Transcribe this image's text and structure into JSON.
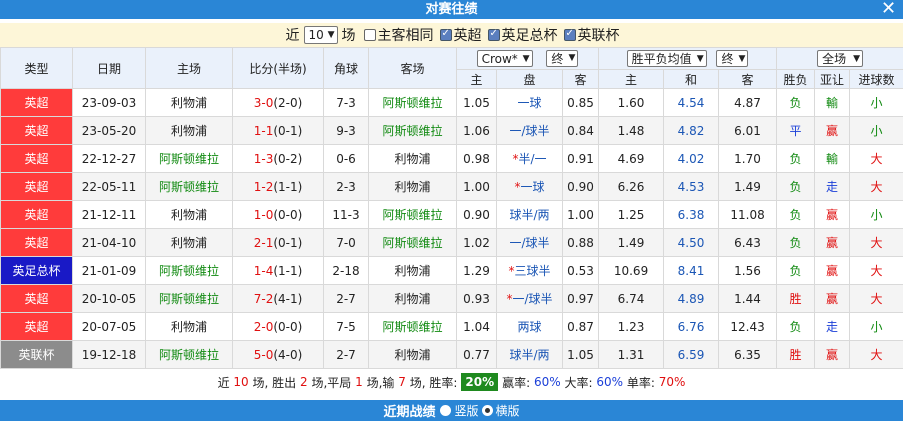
{
  "title": "对赛往绩",
  "filter": {
    "prefix": "近",
    "count": "10",
    "suffix": "场",
    "same_home": "主客相同",
    "same_home_checked": false,
    "leagues": [
      {
        "label": "英超",
        "checked": true
      },
      {
        "label": "英足总杯",
        "checked": true
      },
      {
        "label": "英联杯",
        "checked": true
      }
    ]
  },
  "header": {
    "type": "类型",
    "date": "日期",
    "home": "主场",
    "score": "比分(半场)",
    "corner": "角球",
    "away": "客场",
    "company": "Crow*",
    "odds_mode": "终",
    "euro_mode": "胜平负均值",
    "euro_odds_mode": "终",
    "result_scope": "全场",
    "sub_home": "主",
    "sub_line": "盘",
    "sub_away": "客",
    "sub_win": "主",
    "sub_draw": "和",
    "sub_lose": "客",
    "sub_result": "胜负",
    "sub_handicap": "亚让",
    "sub_goals": "进球数"
  },
  "rows": [
    {
      "league": "英超",
      "league_color": "red",
      "date": "23-09-03",
      "home": "利物浦",
      "home_green": false,
      "score_a": "3",
      "score_b": "0",
      "half": "(2-0)",
      "corner": "7-3",
      "away": "阿斯顿维拉",
      "away_green": true,
      "o_home": "1.05",
      "line_prefix": "",
      "line": "一球",
      "o_away": "0.85",
      "e_win": "1.60",
      "e_draw": "4.54",
      "e_lose": "4.87",
      "result": "负",
      "result_color": "green",
      "hcap": "輸",
      "hcap_color": "green",
      "goals": "小",
      "goals_color": "green"
    },
    {
      "league": "英超",
      "league_color": "red",
      "date": "23-05-20",
      "home": "利物浦",
      "home_green": false,
      "score_a": "1",
      "score_b": "1",
      "half": "(0-1)",
      "corner": "9-3",
      "away": "阿斯顿维拉",
      "away_green": true,
      "o_home": "1.06",
      "line_prefix": "",
      "line": "一/球半",
      "o_away": "0.84",
      "e_win": "1.48",
      "e_draw": "4.82",
      "e_lose": "6.01",
      "result": "平",
      "result_color": "blue",
      "hcap": "赢",
      "hcap_color": "red",
      "goals": "小",
      "goals_color": "green"
    },
    {
      "league": "英超",
      "league_color": "red",
      "date": "22-12-27",
      "home": "阿斯顿维拉",
      "home_green": true,
      "score_a": "1",
      "score_b": "3",
      "half": "(0-2)",
      "corner": "0-6",
      "away": "利物浦",
      "away_green": false,
      "o_home": "0.98",
      "line_prefix": "*",
      "line": "半/一",
      "o_away": "0.91",
      "e_win": "4.69",
      "e_draw": "4.02",
      "e_lose": "1.70",
      "result": "负",
      "result_color": "green",
      "hcap": "輸",
      "hcap_color": "green",
      "goals": "大",
      "goals_color": "red"
    },
    {
      "league": "英超",
      "league_color": "red",
      "date": "22-05-11",
      "home": "阿斯顿维拉",
      "home_green": true,
      "score_a": "1",
      "score_b": "2",
      "half": "(1-1)",
      "corner": "2-3",
      "away": "利物浦",
      "away_green": false,
      "o_home": "1.00",
      "line_prefix": "*",
      "line": "一球",
      "o_away": "0.90",
      "e_win": "6.26",
      "e_draw": "4.53",
      "e_lose": "1.49",
      "result": "负",
      "result_color": "green",
      "hcap": "走",
      "hcap_color": "blue",
      "goals": "大",
      "goals_color": "red"
    },
    {
      "league": "英超",
      "league_color": "red",
      "date": "21-12-11",
      "home": "利物浦",
      "home_green": false,
      "score_a": "1",
      "score_b": "0",
      "half": "(0-0)",
      "corner": "11-3",
      "away": "阿斯顿维拉",
      "away_green": true,
      "o_home": "0.90",
      "line_prefix": "",
      "line": "球半/两",
      "o_away": "1.00",
      "e_win": "1.25",
      "e_draw": "6.38",
      "e_lose": "11.08",
      "result": "负",
      "result_color": "green",
      "hcap": "赢",
      "hcap_color": "red",
      "goals": "小",
      "goals_color": "green"
    },
    {
      "league": "英超",
      "league_color": "red",
      "date": "21-04-10",
      "home": "利物浦",
      "home_green": false,
      "score_a": "2",
      "score_b": "1",
      "half": "(0-1)",
      "corner": "7-0",
      "away": "阿斯顿维拉",
      "away_green": true,
      "o_home": "1.02",
      "line_prefix": "",
      "line": "一/球半",
      "o_away": "0.88",
      "e_win": "1.49",
      "e_draw": "4.50",
      "e_lose": "6.43",
      "result": "负",
      "result_color": "green",
      "hcap": "赢",
      "hcap_color": "red",
      "goals": "大",
      "goals_color": "red"
    },
    {
      "league": "英足总杯",
      "league_color": "blue",
      "date": "21-01-09",
      "home": "阿斯顿维拉",
      "home_green": true,
      "score_a": "1",
      "score_b": "4",
      "half": "(1-1)",
      "corner": "2-18",
      "away": "利物浦",
      "away_green": false,
      "o_home": "1.29",
      "line_prefix": "*",
      "line": "三球半",
      "o_away": "0.53",
      "e_win": "10.69",
      "e_draw": "8.41",
      "e_lose": "1.56",
      "result": "负",
      "result_color": "green",
      "hcap": "赢",
      "hcap_color": "red",
      "goals": "大",
      "goals_color": "red"
    },
    {
      "league": "英超",
      "league_color": "red",
      "date": "20-10-05",
      "home": "阿斯顿维拉",
      "home_green": true,
      "score_a": "7",
      "score_b": "2",
      "half": "(4-1)",
      "corner": "2-7",
      "away": "利物浦",
      "away_green": false,
      "o_home": "0.93",
      "line_prefix": "*",
      "line": "一/球半",
      "o_away": "0.97",
      "e_win": "6.74",
      "e_draw": "4.89",
      "e_lose": "1.44",
      "result": "胜",
      "result_color": "red",
      "hcap": "赢",
      "hcap_color": "red",
      "goals": "大",
      "goals_color": "red"
    },
    {
      "league": "英超",
      "league_color": "red",
      "date": "20-07-05",
      "home": "利物浦",
      "home_green": false,
      "score_a": "2",
      "score_b": "0",
      "half": "(0-0)",
      "corner": "7-5",
      "away": "阿斯顿维拉",
      "away_green": true,
      "o_home": "1.04",
      "line_prefix": "",
      "line": "两球",
      "o_away": "0.87",
      "e_win": "1.23",
      "e_draw": "6.76",
      "e_lose": "12.43",
      "result": "负",
      "result_color": "green",
      "hcap": "走",
      "hcap_color": "blue",
      "goals": "小",
      "goals_color": "green"
    },
    {
      "league": "英联杯",
      "league_color": "gray",
      "date": "19-12-18",
      "home": "阿斯顿维拉",
      "home_green": true,
      "score_a": "5",
      "score_b": "0",
      "half": "(4-0)",
      "corner": "2-7",
      "away": "利物浦",
      "away_green": false,
      "o_home": "0.77",
      "line_prefix": "",
      "line": "球半/两",
      "o_away": "1.05",
      "e_win": "1.31",
      "e_draw": "6.59",
      "e_lose": "6.35",
      "result": "胜",
      "result_color": "red",
      "hcap": "赢",
      "hcap_color": "red",
      "goals": "大",
      "goals_color": "red"
    }
  ],
  "summary": {
    "t1": "近",
    "n_total": "10",
    "t2": "场, 胜出",
    "n_win": "2",
    "t3": "场,平局",
    "n_draw": "1",
    "t4": "场,输",
    "n_lose": "7",
    "t5": "场, 胜率:",
    "win_rate": "20%",
    "t6": "赢率:",
    "hcap_rate": "60%",
    "t7": "大率:",
    "big_rate": "60%",
    "t8": "单率:",
    "odd_rate": "70%"
  },
  "footer": {
    "title": "近期战绩",
    "opt1": "竖版",
    "opt2": "横版",
    "selected": "opt2"
  },
  "colors": {
    "header_blue": "#2a86d6",
    "league_red": "#ff3b3b",
    "league_blue": "#1919c6",
    "league_gray": "#8c8c8c",
    "win_red": "#e01010",
    "lose_green": "#118a11",
    "draw_blue": "#1b3fd8"
  }
}
